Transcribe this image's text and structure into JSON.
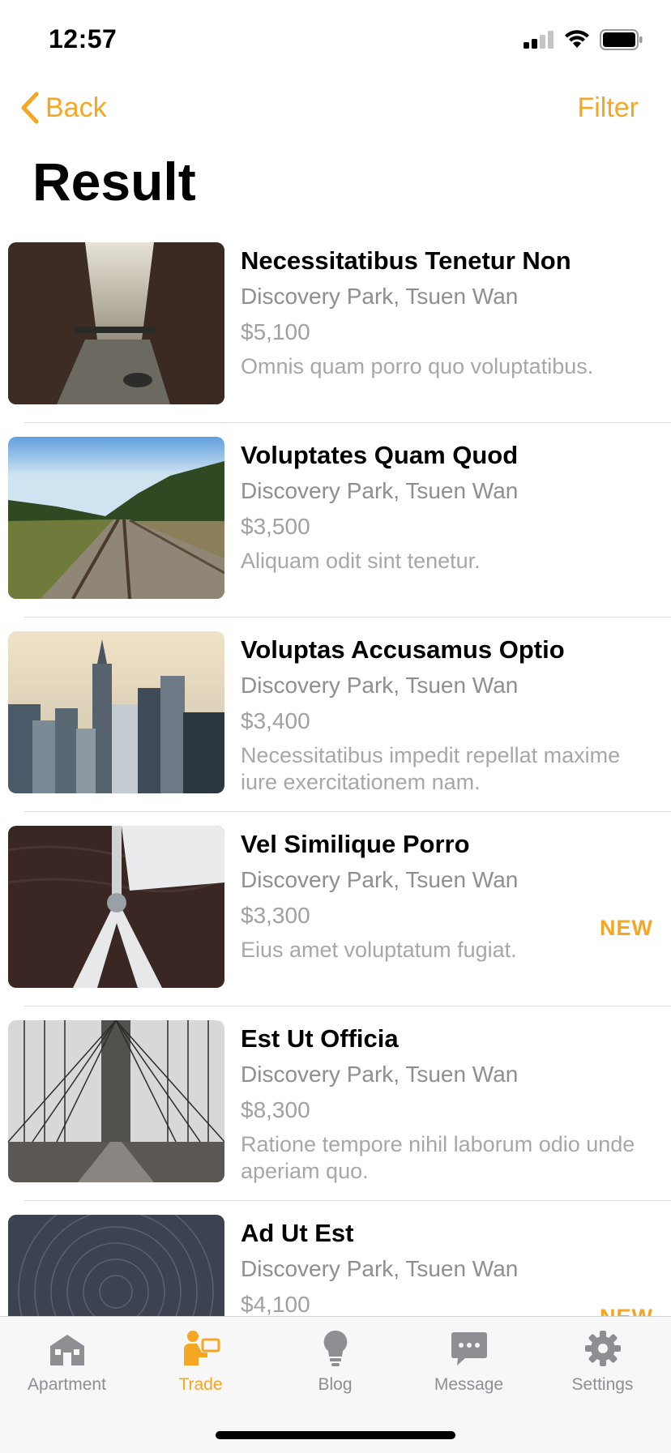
{
  "status_bar": {
    "time": "12:57"
  },
  "nav": {
    "back_label": "Back",
    "filter_label": "Filter"
  },
  "page": {
    "title": "Result"
  },
  "listings": [
    {
      "title": "Necessitatibus Tenetur Non",
      "location": "Discovery Park, Tsuen Wan",
      "price": "$5,100",
      "description": "Omnis quam porro quo voluptatibus.",
      "badge": "",
      "image": "canal-photo"
    },
    {
      "title": "Voluptates Quam Quod",
      "location": "Discovery Park, Tsuen Wan",
      "price": "$3,500",
      "description": "Aliquam odit sint tenetur.",
      "badge": "",
      "image": "railway-photo"
    },
    {
      "title": "Voluptas Accusamus Optio",
      "location": "Discovery Park, Tsuen Wan",
      "price": "$3,400",
      "description": "Necessitatibus impedit repellat maxime iure exercitationem nam.",
      "badge": "",
      "image": "city-skyline-photo"
    },
    {
      "title": "Vel Similique Porro",
      "location": "Discovery Park, Tsuen Wan",
      "price": "$3,300",
      "description": "Eius amet voluptatum fugiat.",
      "badge": "NEW",
      "image": "sailboat-photo"
    },
    {
      "title": "Est Ut Officia",
      "location": "Discovery Park, Tsuen Wan",
      "price": "$8,300",
      "description": "Ratione tempore nihil laborum odio unde aperiam quo.",
      "badge": "",
      "image": "bridge-photo"
    },
    {
      "title": "Ad Ut Est",
      "location": "Discovery Park, Tsuen Wan",
      "price": "$4,100",
      "description": "",
      "badge": "NEW",
      "image": "star-trails-photo"
    }
  ],
  "tabs": [
    {
      "label": "Apartment",
      "icon": "apartment-icon",
      "active": false
    },
    {
      "label": "Trade",
      "icon": "trade-icon",
      "active": true
    },
    {
      "label": "Blog",
      "icon": "lightbulb-icon",
      "active": false
    },
    {
      "label": "Message",
      "icon": "message-icon",
      "active": false
    },
    {
      "label": "Settings",
      "icon": "gear-icon",
      "active": false
    }
  ],
  "colors": {
    "accent": "#f5a623",
    "secondary_text": "#8e8e93",
    "inactive_tab": "#8e8e93"
  }
}
